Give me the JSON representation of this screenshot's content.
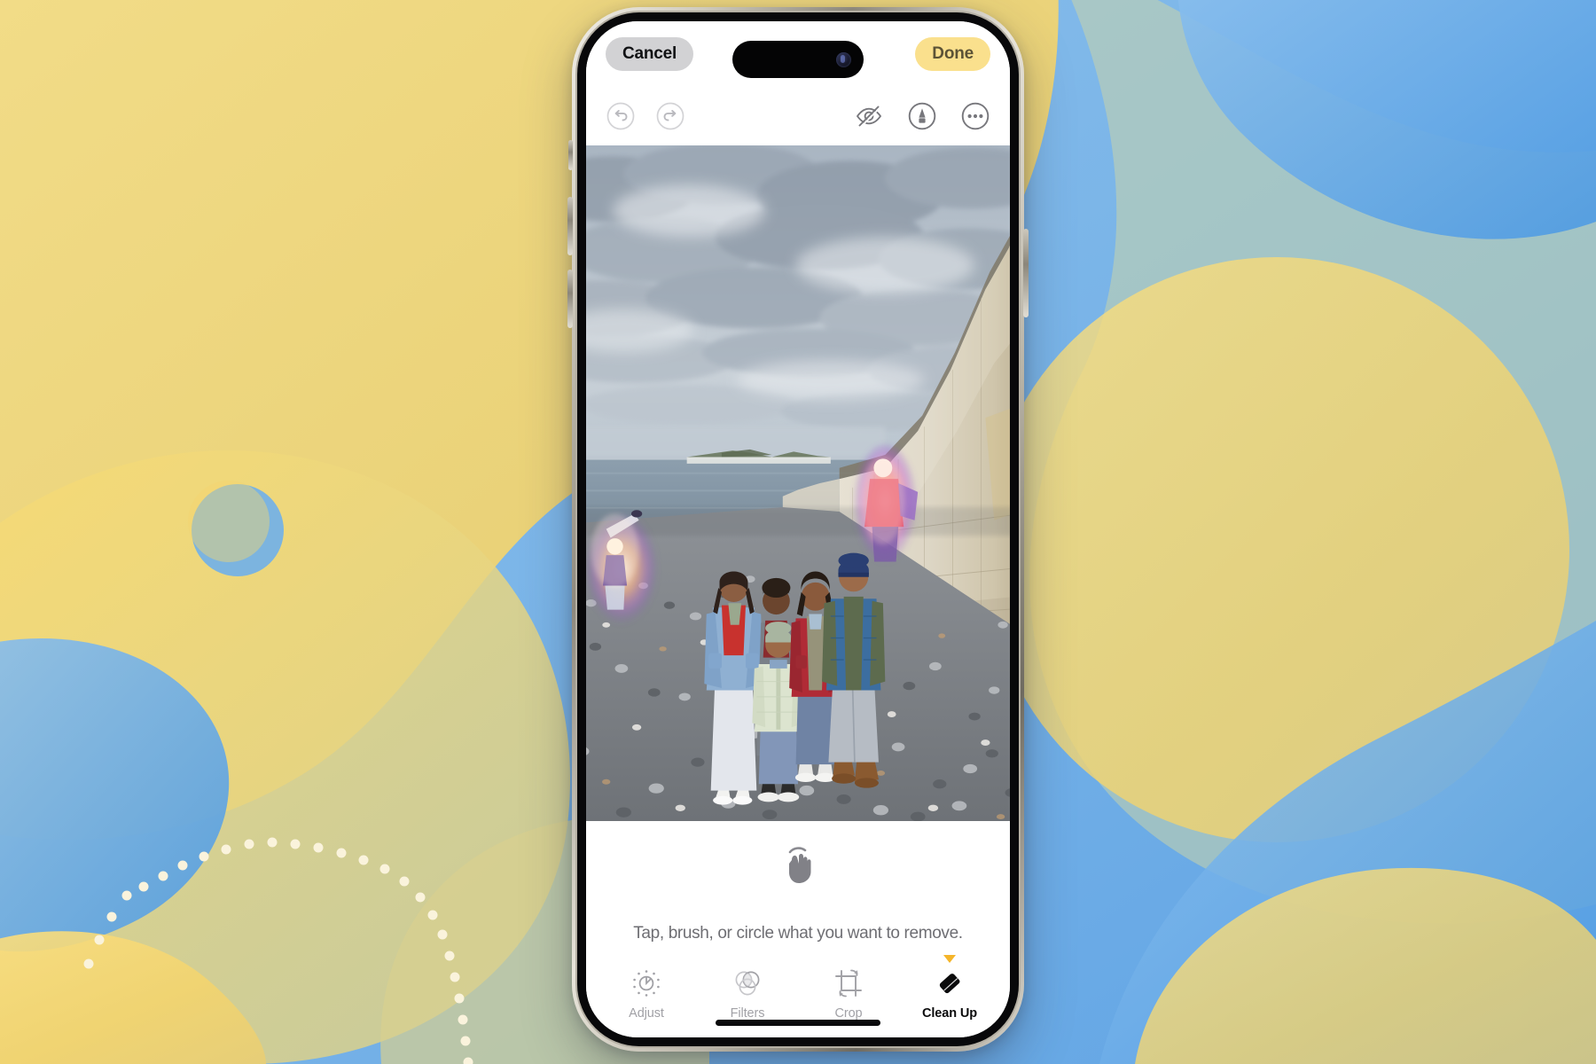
{
  "background": {
    "base_color": "#7FB8E8",
    "blob_yellow": "#F6D873",
    "blob_blue": "#79B4E8",
    "dot_color": "#FAF3DC",
    "description": "abstract organic blob wallpaper"
  },
  "device": {
    "name": "iphone-16-pro",
    "frame_color": "#B5B0A4",
    "dynamic_island": "dynamic-island",
    "camera_lens": "front-camera-lens",
    "home_indicator": "home-indicator"
  },
  "topbar": {
    "cancel_label": "Cancel",
    "done_label": "Done",
    "cancel_bg": "#D2D2D4",
    "done_bg": "#FAE08D"
  },
  "toolrow": {
    "left": [
      {
        "name": "undo-icon",
        "label": "Undo",
        "enabled": false
      },
      {
        "name": "redo-icon",
        "label": "Redo",
        "enabled": false
      }
    ],
    "right": [
      {
        "name": "eye-slash-icon",
        "label": "Hide Markup"
      },
      {
        "name": "markup-pen-icon",
        "label": "Markup"
      },
      {
        "name": "ellipsis-icon",
        "label": "More Options"
      }
    ]
  },
  "photo": {
    "name": "beach-family-photo",
    "scene": "Family of five on a pebble beach with white chalk cliffs and cloudy sky",
    "people_count": 5,
    "highlighted_objects": 2,
    "highlight_note": "Two background figures glowing, selected for Clean Up removal"
  },
  "bottom": {
    "gesture_icon": "tap-hand-icon",
    "hint": "Tap, brush, or circle what you want to remove."
  },
  "tabs": [
    {
      "icon": "adjust-dial-icon",
      "label": "Adjust",
      "active": false
    },
    {
      "icon": "filters-circles-icon",
      "label": "Filters",
      "active": false
    },
    {
      "icon": "crop-frame-icon",
      "label": "Crop",
      "active": false
    },
    {
      "icon": "eraser-icon",
      "label": "Clean Up",
      "active": true,
      "marker_color": "#F5B52A"
    }
  ]
}
